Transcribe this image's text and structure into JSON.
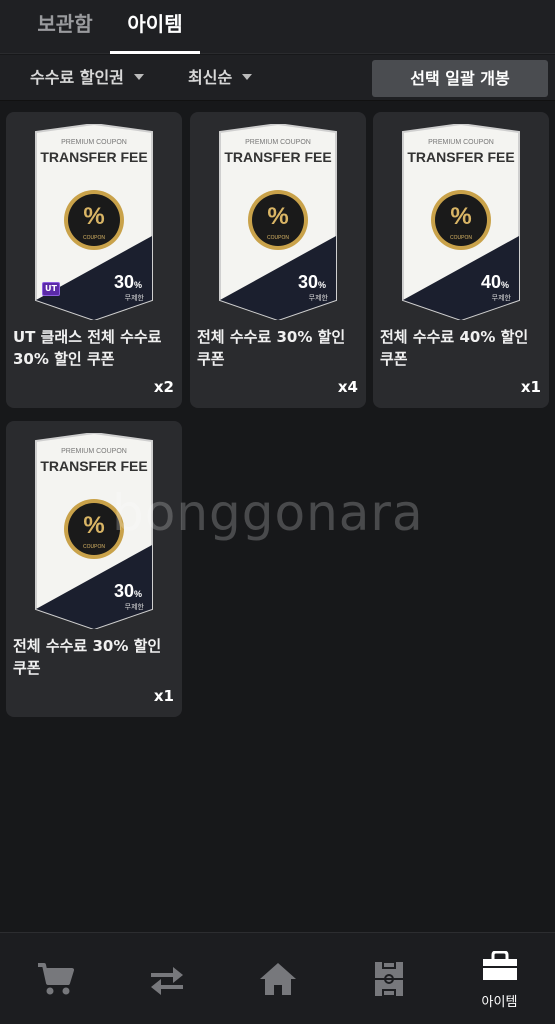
{
  "tabs": {
    "storage": "보관함",
    "items": "아이템"
  },
  "filters": {
    "coupon_type": "수수료 할인권",
    "sort": "최신순",
    "bulk_open": "선택 일괄 개봉"
  },
  "coupon_art": {
    "premium": "PREMIUM COUPON",
    "transfer": "TRANSFER FEE",
    "percent": "%",
    "coupon": "COUPON",
    "unlimited": "무제한"
  },
  "cards": [
    {
      "title": "UT 클래스 전체 수수료 30% 할인 쿠폰",
      "discount": "30",
      "qty": "x2",
      "badge": "UT"
    },
    {
      "title": "전체 수수료 30% 할인 쿠폰",
      "discount": "30",
      "qty": "x4"
    },
    {
      "title": "전체 수수료 40% 할인 쿠폰",
      "discount": "40",
      "qty": "x1"
    },
    {
      "title": "전체 수수료 30% 할인 쿠폰",
      "discount": "30",
      "qty": "x1"
    }
  ],
  "watermark": "bonggonara",
  "bottom_nav": {
    "items_label": "아이템",
    "icons": [
      "cart-icon",
      "transfer-icon",
      "home-icon",
      "field-icon",
      "bag-icon"
    ]
  },
  "colors": {
    "background": "#17181a",
    "card": "#2a2b2e",
    "button": "#4a4c50",
    "gold": "#c9a24a"
  }
}
